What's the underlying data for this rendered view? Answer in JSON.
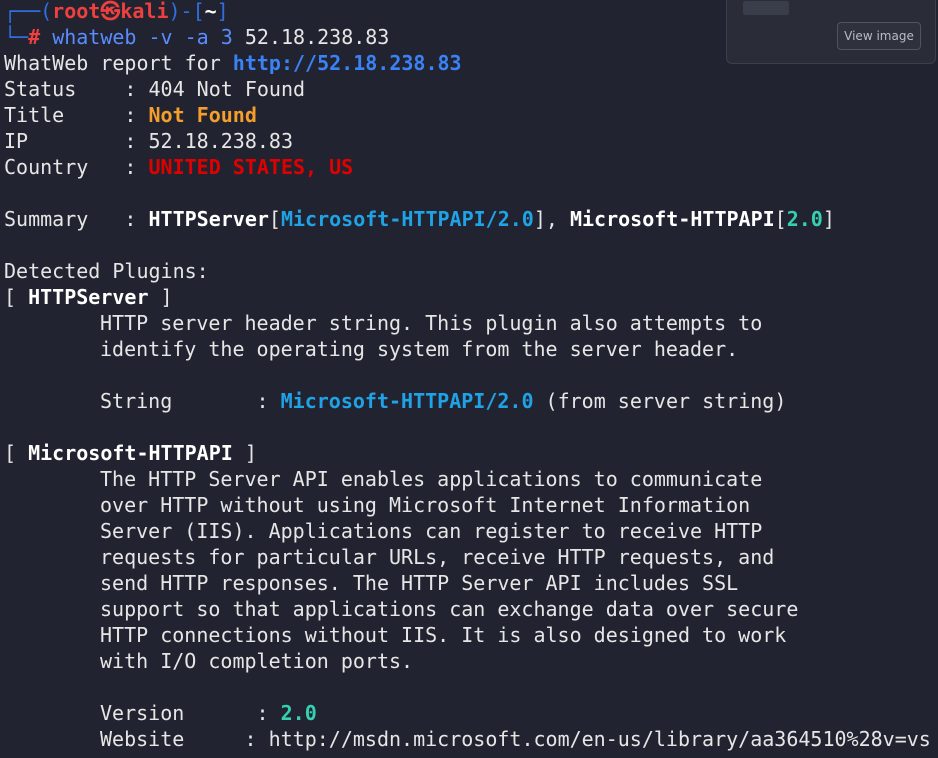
{
  "prompt": {
    "corner_top": "┌──(",
    "user": "root㉿kali",
    "mid": ")-[",
    "dir": "~",
    "close": "]",
    "corner_bottom": "└─",
    "hash": "#",
    "command": "whatweb -v -a 3",
    "target": "52.18.238.83"
  },
  "report": {
    "header_prefix": "WhatWeb report for ",
    "header_url": "http://52.18.238.83",
    "status_label": "Status    : ",
    "status_value": "404 Not Found",
    "title_label": "Title     : ",
    "title_value": "Not Found",
    "ip_label": "IP        : ",
    "ip_value": "52.18.238.83",
    "country_label": "Country   : ",
    "country_value": "UNITED STATES, US",
    "summary_label": "Summary   : ",
    "summary_parts": [
      "HTTPServer",
      "[",
      "Microsoft-HTTPAPI/2.0",
      "], ",
      "Microsoft-HTTPAPI",
      "[",
      "2.0",
      "]"
    ]
  },
  "plugins": {
    "heading": "Detected Plugins:",
    "bracket_open": "[ ",
    "bracket_close": " ]",
    "httpserver": {
      "name": "HTTPServer",
      "desc": [
        "HTTP server header string. This plugin also attempts to",
        "identify the operating system from the server header."
      ],
      "string_label": "String       : ",
      "string_value": "Microsoft-HTTPAPI/2.0",
      "string_suffix": " (from server string)"
    },
    "httpapi": {
      "name": "Microsoft-HTTPAPI",
      "desc": [
        "The HTTP Server API enables applications to communicate",
        "over HTTP without using Microsoft Internet Information",
        "Server (IIS). Applications can register to receive HTTP",
        "requests for particular URLs, receive HTTP requests, and",
        "send HTTP responses. The HTTP Server API includes SSL",
        "support so that applications can exchange data over secure",
        "HTTP connections without IIS. It is also designed to work",
        "with I/O completion ports."
      ],
      "version_label": "Version      : ",
      "version_value": "2.0",
      "website_label": "Website     : ",
      "website_value": "http://msdn.microsoft.com/en-us/library/aa364510%28v=vs"
    }
  },
  "overlay": {
    "view_image_label": "View image"
  }
}
